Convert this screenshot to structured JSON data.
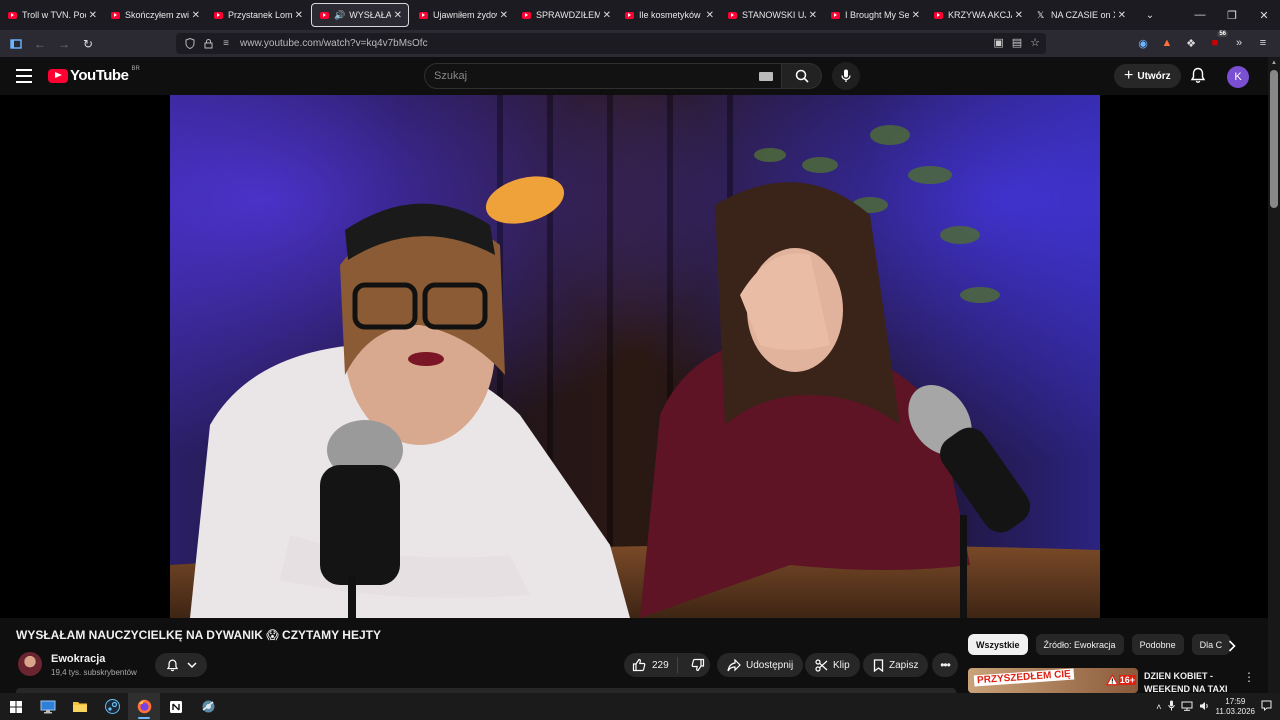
{
  "browser": {
    "tabs": [
      {
        "title": "Troll w TVN. Poczu",
        "icon": "youtube-icon"
      },
      {
        "title": "Skończyłem związ",
        "icon": "youtube-icon"
      },
      {
        "title": "Przystanek Lomba",
        "icon": "youtube-icon"
      },
      {
        "title": "WYSŁAŁAM N",
        "icon": "youtube-icon",
        "active": true,
        "audio": true
      },
      {
        "title": "Ujawniłem żydows",
        "icon": "youtube-icon"
      },
      {
        "title": "SPRAWDZIŁEM CZ",
        "icon": "youtube-icon"
      },
      {
        "title": "Ile kosmetyków w",
        "icon": "youtube-icon"
      },
      {
        "title": "STANOWSKI UJAW",
        "icon": "youtube-icon"
      },
      {
        "title": "I Brought My Secr",
        "icon": "youtube-icon"
      },
      {
        "title": "KRZYWA AKCJA #",
        "icon": "youtube-icon"
      },
      {
        "title": "NA CZASIE on X: \"",
        "icon": "x-icon"
      }
    ],
    "url": "www.youtube.com/watch?v=kq4v7bMsOfc",
    "extension_badge": "56"
  },
  "youtube": {
    "logo_text": "YouTube",
    "country_code": "BR",
    "search_placeholder": "Szukaj",
    "create_label": "Utwórz",
    "avatar_letter": "K",
    "accent": "#ff0033"
  },
  "video": {
    "title": "WYSŁAŁAM NAUCZYCIELKĘ NA DYWANIK 😱 CZYTAMY HEJTY",
    "channel": "Ewokracja",
    "subscribers": "19,4 tys. subskrybentów",
    "likes": "229",
    "share_label": "Udostępnij",
    "clip_label": "Klip",
    "save_label": "Zapisz"
  },
  "sidebar": {
    "chips": [
      "Wszystkie",
      "Źródło: Ewokracja",
      "Podobne",
      "Dla C"
    ],
    "recommendation": {
      "title_line1": "DZIEN KOBIET -",
      "title_line2": "WEEKEND NA TAXI",
      "thumb_text": "PRZYSZEDŁEM CIĘ",
      "thumb_badge": "16+"
    }
  },
  "taskbar": {
    "time": "17:59",
    "date": "11.03.2026"
  }
}
